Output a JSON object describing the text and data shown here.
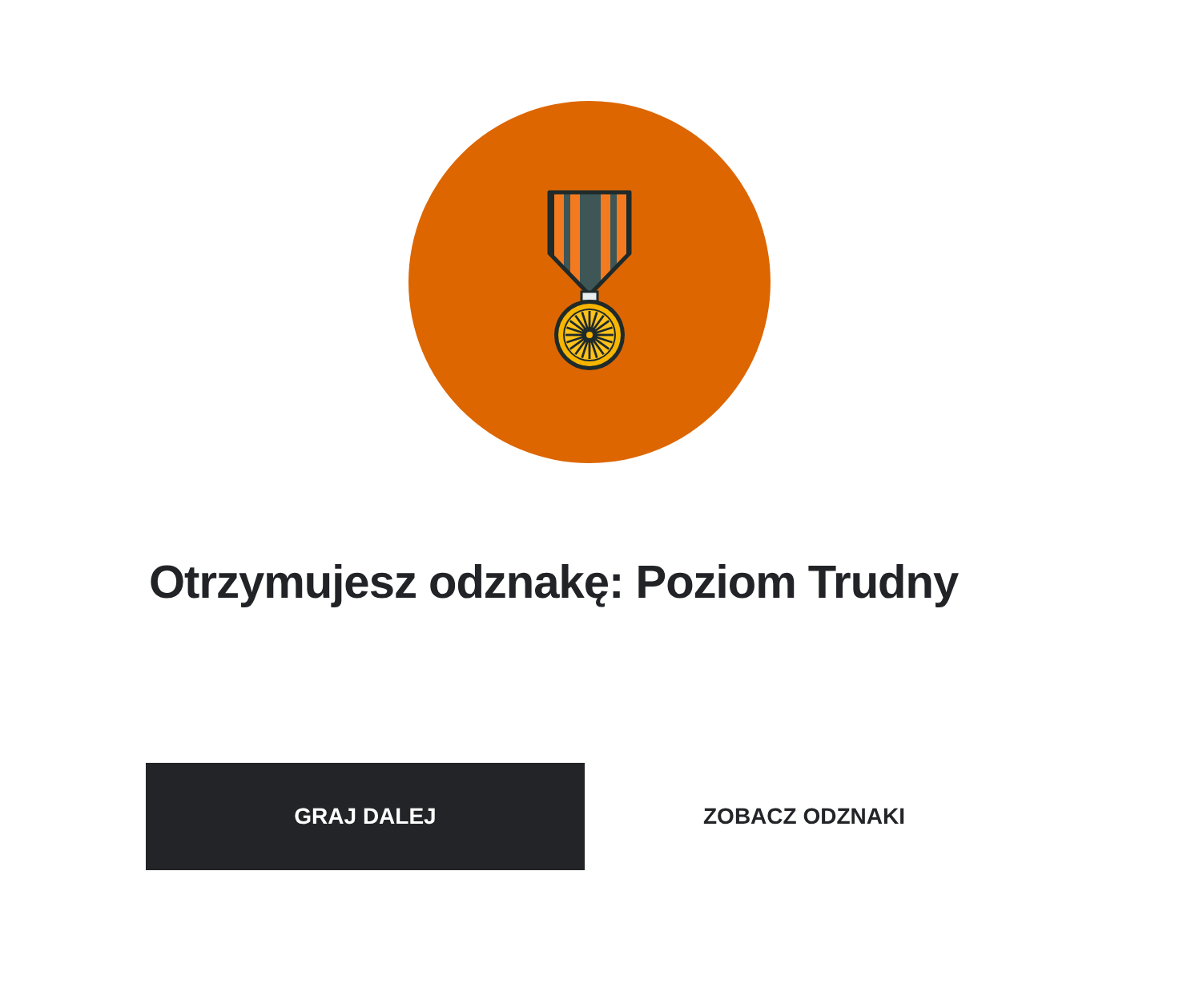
{
  "badge": {
    "title": "Otrzymujesz odznakę: Poziom Trudny"
  },
  "buttons": [
    {
      "label": "GRAJ DALEJ",
      "kind": "primary"
    },
    {
      "label": "ZOBACZ ODZNAKI",
      "kind": "secondary"
    }
  ]
}
